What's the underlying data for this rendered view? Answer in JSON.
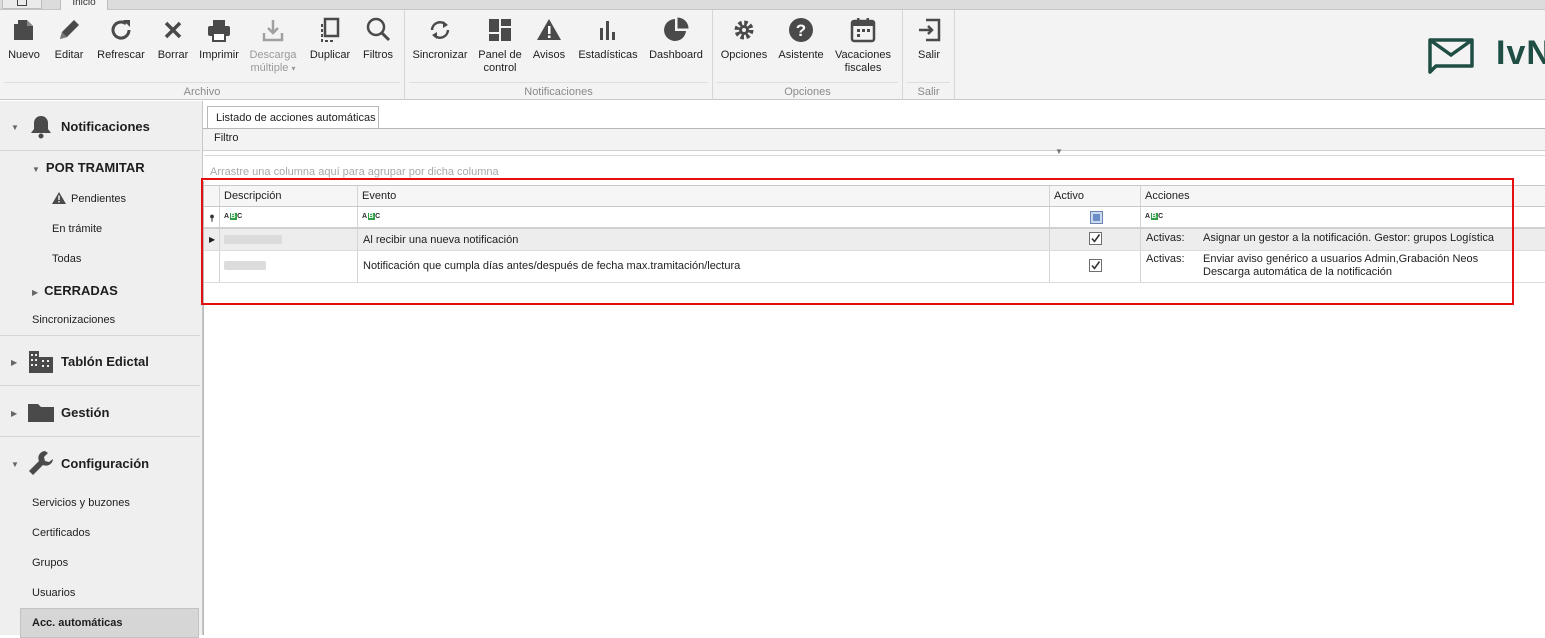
{
  "window": {
    "tab_label": "Inicio"
  },
  "ribbon": {
    "groups": [
      {
        "label": "Archivo",
        "buttons": [
          {
            "label": "Nuevo",
            "icon": "new-document-icon"
          },
          {
            "label": "Editar",
            "icon": "pencil-icon"
          },
          {
            "label": "Refrescar",
            "icon": "refresh-icon"
          },
          {
            "label": "Borrar",
            "icon": "delete-x-icon"
          },
          {
            "label": "Imprimir",
            "icon": "printer-icon"
          },
          {
            "label": "Descarga",
            "label2": "múltiple",
            "icon": "download-icon",
            "disabled": true
          },
          {
            "label": "Duplicar",
            "icon": "duplicate-icon"
          },
          {
            "label": "Filtros",
            "icon": "search-icon"
          }
        ]
      },
      {
        "label": "Notificaciones",
        "buttons": [
          {
            "label": "Sincronizar",
            "icon": "sync-icon"
          },
          {
            "label": "Panel de",
            "label2": "control",
            "icon": "dashboard-panel-icon"
          },
          {
            "label": "Avisos",
            "icon": "warning-icon"
          },
          {
            "label": "Estadísticas",
            "icon": "bar-chart-icon"
          },
          {
            "label": "Dashboard",
            "icon": "pie-chart-icon"
          }
        ]
      },
      {
        "label": "Opciones",
        "buttons": [
          {
            "label": "Opciones",
            "icon": "gear-icon"
          },
          {
            "label": "Asistente",
            "icon": "help-icon"
          },
          {
            "label": "Vacaciones",
            "label2": "fiscales",
            "icon": "calendar-icon"
          }
        ]
      },
      {
        "label": "Salir",
        "buttons": [
          {
            "label": "Salir",
            "icon": "exit-icon"
          }
        ]
      }
    ],
    "logo_text": "IvN"
  },
  "sidebar": {
    "notificaciones": "Notificaciones",
    "por_tramitar": "POR TRAMITAR",
    "pendientes": "Pendientes",
    "en_tramite": "En trámite",
    "todas": "Todas",
    "cerradas": "CERRADAS",
    "sincronizaciones": "Sincronizaciones",
    "tablon": "Tablón Edictal",
    "gestion": "Gestión",
    "configuracion": "Configuración",
    "servicios": "Servicios y buzones",
    "certificados": "Certificados",
    "grupos": "Grupos",
    "usuarios": "Usuarios",
    "acc_automaticas": "Acc. automáticas"
  },
  "main": {
    "doc_tab": "Listado de acciones automáticas",
    "filter_label": "Filtro",
    "group_hint": "Arrastre una columna aquí para agrupar por dicha columna",
    "grid": {
      "columns": [
        "Descripción",
        "Evento",
        "Activo",
        "Acciones"
      ],
      "filter_abc": "ABC",
      "rows": [
        {
          "evento": "Al recibir una nueva notificación",
          "activo": true,
          "acciones_label": "Activas:",
          "acciones_lines": [
            "Asignar un gestor a la notificación. Gestor: grupos Logística"
          ]
        },
        {
          "evento": "Notificación que cumpla días antes/después de fecha max.tramitación/lectura",
          "activo": true,
          "acciones_label": "Activas:",
          "acciones_lines": [
            "Enviar aviso genérico a usuarios Admin,Grabación Neos",
            "Descarga automática de la notificación"
          ]
        }
      ]
    }
  }
}
